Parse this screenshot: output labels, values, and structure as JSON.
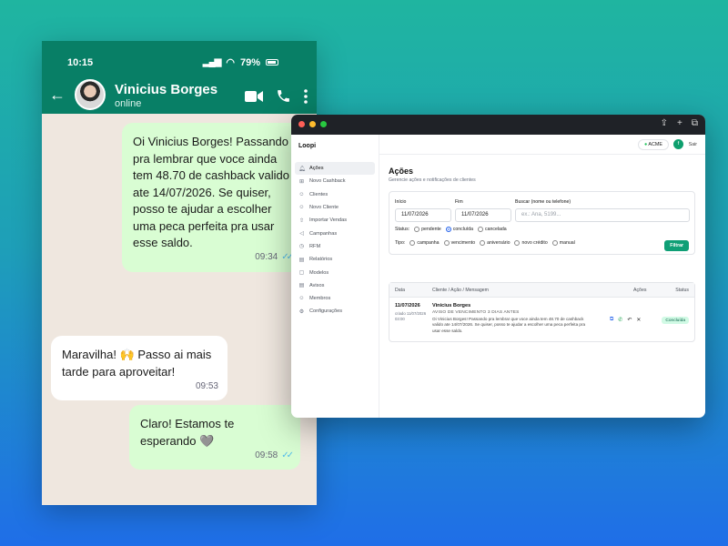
{
  "phone": {
    "time": "10:15",
    "battery": "79%",
    "contact_name": "Vinicius Borges",
    "contact_status": "online",
    "messages": [
      {
        "text": "Oi Vinicius Borges! Passando pra lembrar que voce ainda tem 48.70 de cashback valido ate 14/07/2026. Se quiser, posso te ajudar a escolher uma peca perfeita pra usar esse saldo.",
        "time": "09:34"
      },
      {
        "text": "Maravilha! 🙌 Passo ai mais tarde para aproveitar!",
        "time": "09:53"
      },
      {
        "text": "Claro! Estamos te esperando 🩶",
        "time": "09:58"
      }
    ]
  },
  "app": {
    "brand": "Loopi",
    "nav": [
      {
        "label": "Ações",
        "icon": "bell-icon"
      },
      {
        "label": "Novo Cashback",
        "icon": "gift-icon"
      },
      {
        "label": "Clientes",
        "icon": "users-icon"
      },
      {
        "label": "Novo Cliente",
        "icon": "user-plus-icon"
      },
      {
        "label": "Importar Vendas",
        "icon": "upload-icon"
      },
      {
        "label": "Campanhas",
        "icon": "megaphone-icon"
      },
      {
        "label": "RFM",
        "icon": "clock-icon"
      },
      {
        "label": "Relatórios",
        "icon": "file-chart-icon"
      },
      {
        "label": "Modelos",
        "icon": "file-icon"
      },
      {
        "label": "Avisos",
        "icon": "file-text-icon"
      },
      {
        "label": "Membros",
        "icon": "users-icon"
      },
      {
        "label": "Configurações",
        "icon": "gear-icon"
      }
    ],
    "topbar": {
      "store": "ACME",
      "avatar_initial": "f",
      "logout": "Sair"
    },
    "page_title": "Ações",
    "page_subtitle": "Gerencie ações e notificações de clientes",
    "filters": {
      "start_label": "Início",
      "start_value": "11/07/2026",
      "end_label": "Fim",
      "end_value": "11/07/2026",
      "search_label": "Buscar (nome ou telefone)",
      "search_placeholder": "ex.: Ana, 5199...",
      "status_label": "Status:",
      "status_options": [
        "pendente",
        "concluída",
        "cancelada"
      ],
      "status_selected": "concluída",
      "type_label": "Tipo:",
      "type_options": [
        "campanha",
        "vencimento",
        "aniversário",
        "novo crédito",
        "manual"
      ],
      "button": "Filtrar"
    },
    "table": {
      "headers": {
        "date": "Data",
        "client": "Cliente / Ação / Mensagem",
        "actions": "Ações",
        "status": "Status"
      },
      "rows": [
        {
          "date": "11/07/2026",
          "date_meta": "criado 11/07/2026 03:00",
          "name": "Vinicius Borges",
          "kind": "AVISO DE VENCIMENTO 3 DIAS ANTES",
          "message": "Oi Vinicius Borges! Passando pra lembrar que voce ainda tem 48.70 de cashback valido ate 14/07/2026. Se quiser, posso te ajudar a escolher uma peca perfeita pra usar esse saldo.",
          "status": "Concluída"
        }
      ]
    }
  },
  "colors": {
    "whatsapp_header": "#087f66",
    "outgoing_bubble": "#d9fdd3",
    "filter_button": "#0f9f76",
    "status_badge": "#d1fae5"
  }
}
